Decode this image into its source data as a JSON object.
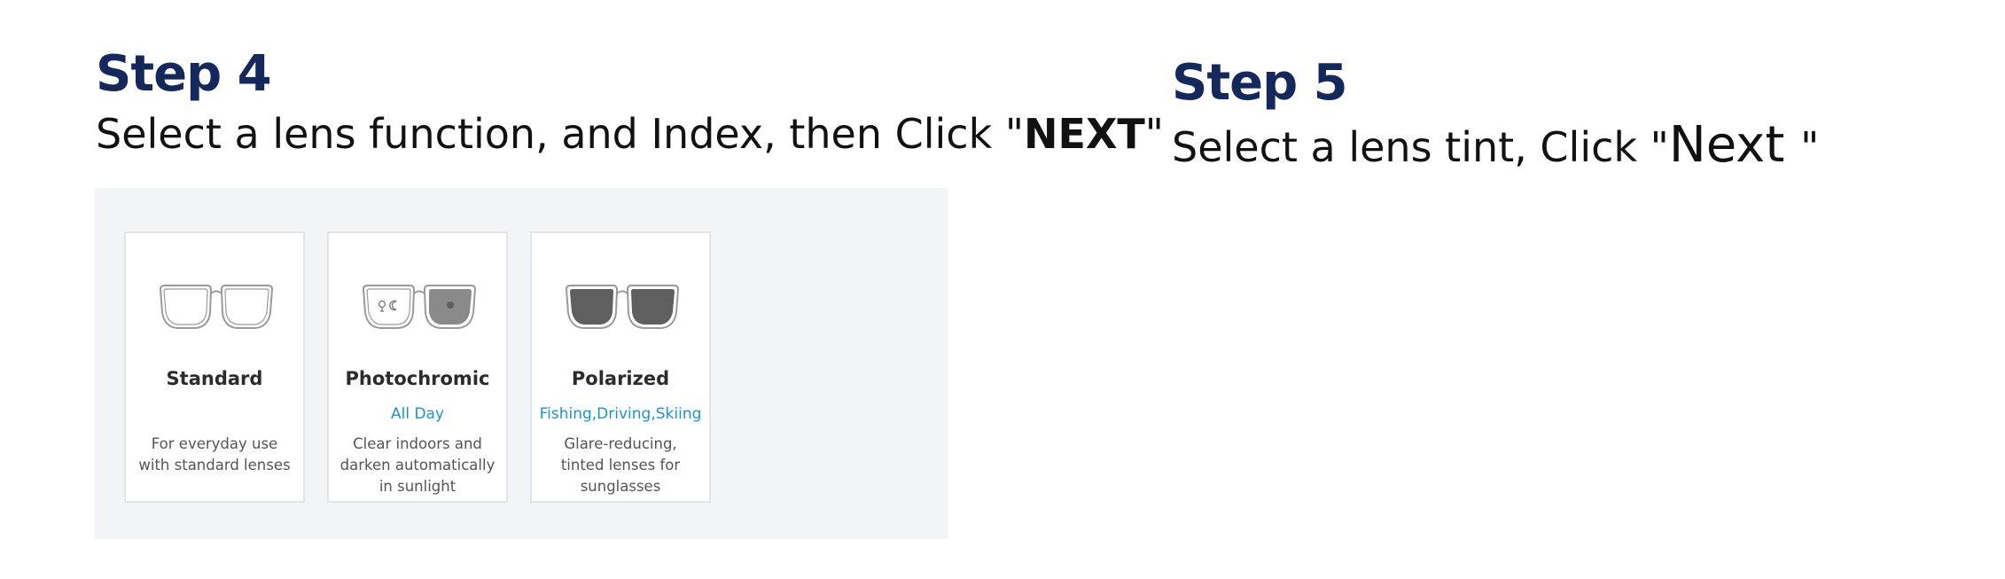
{
  "step4": {
    "title": "Step 4",
    "instruction_prefix": "Select a lens function, and Index, then Click \"",
    "instruction_keyword": "NEXT",
    "instruction_suffix": "\""
  },
  "step5": {
    "title": "Step 5",
    "instruction_prefix": "Select a lens tint, Click \"",
    "instruction_keyword": "Next ",
    "instruction_suffix": "\""
  },
  "lens_options": [
    {
      "name": "Standard",
      "subtitle": "",
      "description_lines": [
        "For everyday use",
        "with standard lenses"
      ],
      "icon": "clear-glasses-icon"
    },
    {
      "name": "Photochromic",
      "subtitle": "All Day",
      "description_lines": [
        "Clear indoors and",
        "darken automatically",
        "in sunlight"
      ],
      "icon": "photochromic-glasses-icon"
    },
    {
      "name": "Polarized",
      "subtitle": "Fishing,Driving,Skiing",
      "description_lines": [
        "Glare-reducing,",
        "tinted lenses for",
        "sunglasses"
      ],
      "icon": "sunglasses-icon"
    }
  ],
  "colors": {
    "heading": "#14285c",
    "subtitle_accent": "#1f93c9",
    "panel_background": "#f3f4f6",
    "tinted_lens": "#606060"
  }
}
